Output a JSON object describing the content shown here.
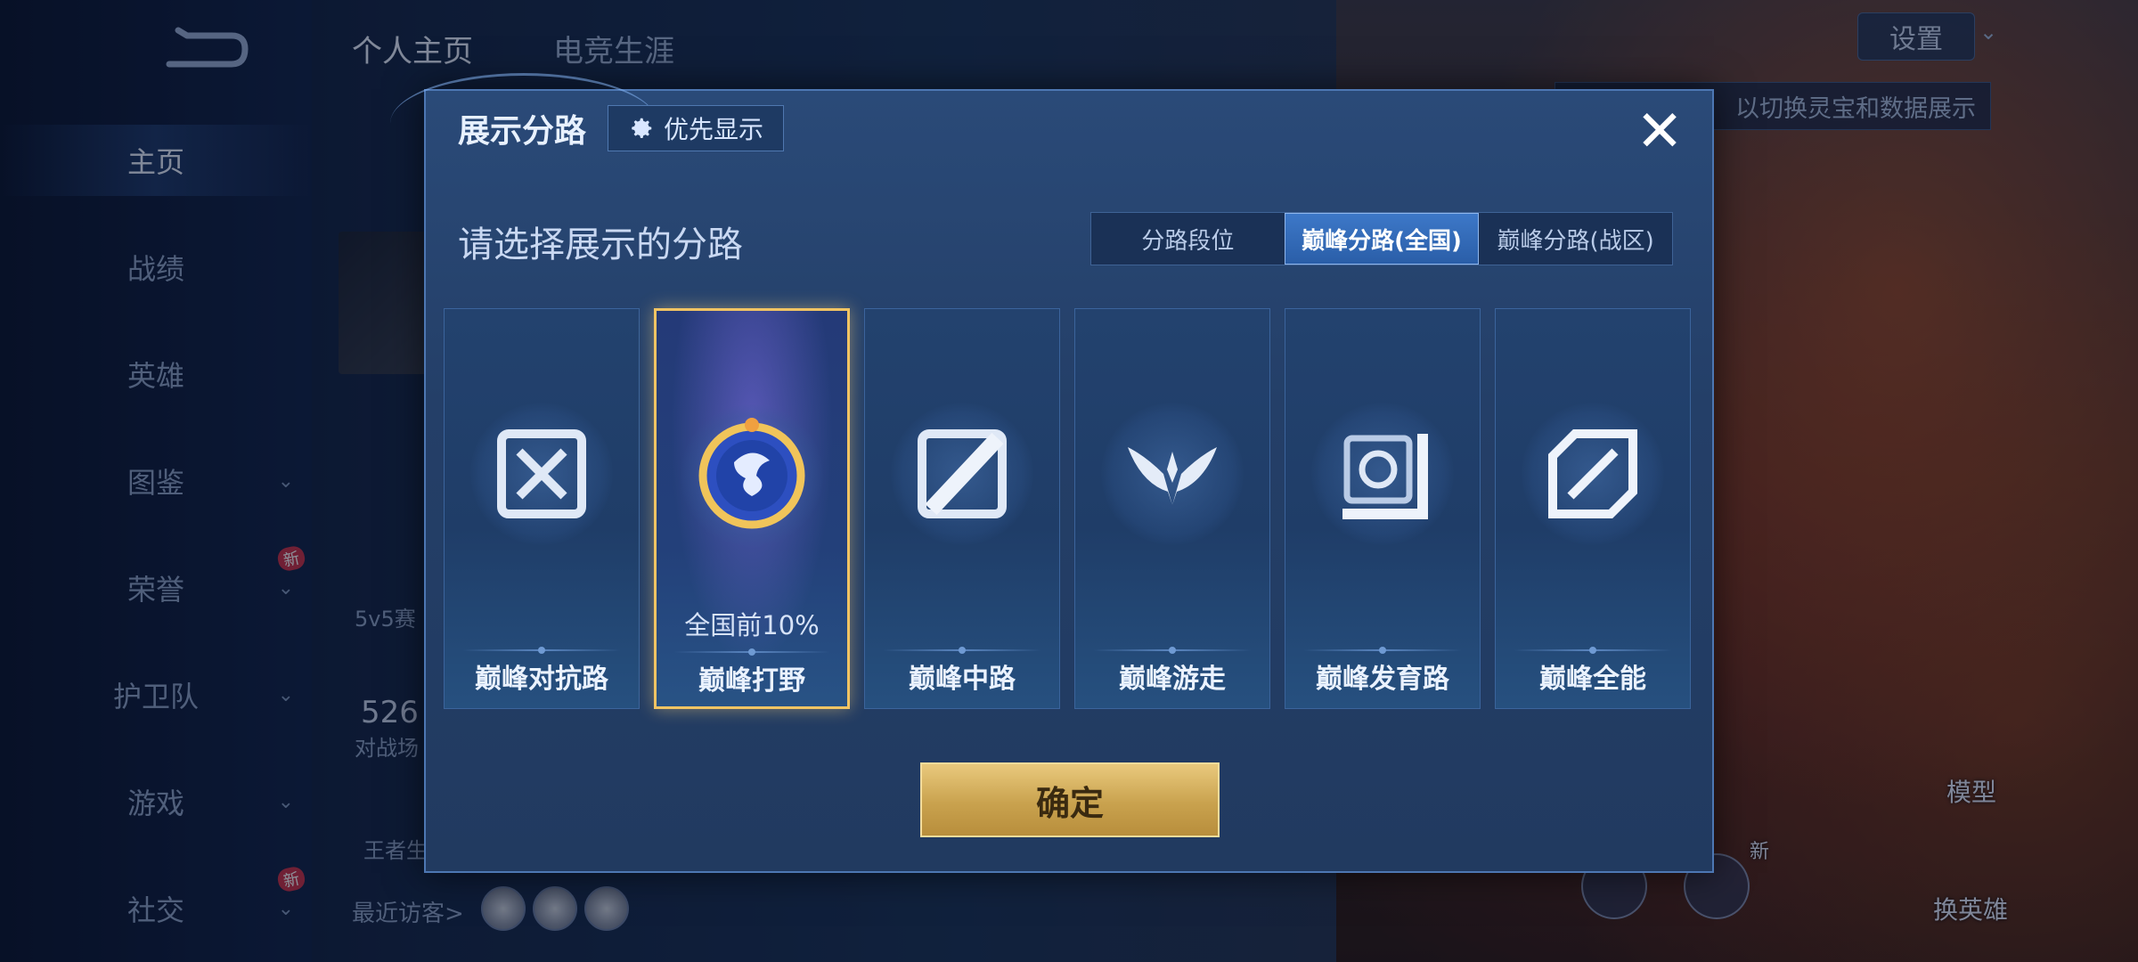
{
  "nav": {
    "items": [
      {
        "label": "主页",
        "active": true
      },
      {
        "label": "战绩"
      },
      {
        "label": "英雄"
      },
      {
        "label": "图鉴",
        "chevron": true
      },
      {
        "label": "荣誉",
        "chevron": true,
        "badge": "新"
      },
      {
        "label": "护卫队",
        "chevron": true
      },
      {
        "label": "游戏",
        "chevron": true
      },
      {
        "label": "社交",
        "chevron": true,
        "badge": "新"
      }
    ]
  },
  "header": {
    "tabs": [
      "个人主页",
      "电竞生涯"
    ],
    "settings_label": "设置",
    "hint_text": "以切换灵宝和数据展示"
  },
  "background": {
    "profile_text_1": "5v5赛",
    "profile_text_2": "526",
    "profile_text_3": "对战场",
    "profile_text_4": "王者生",
    "visitor_label": "最近访客>",
    "model_label": "模型",
    "switch_hero_label": "换英雄",
    "new_badge": "新"
  },
  "modal": {
    "title": "展示分路",
    "priority_label": "优先显示",
    "close_symbol": "✕",
    "subtitle": "请选择展示的分路",
    "segments": [
      "分路段位",
      "巅峰分路(全国)",
      "巅峰分路(战区)"
    ],
    "selected_segment": "巅峰分路(全国)",
    "lanes": [
      {
        "label": "巅峰对抗路",
        "icon": "clash-lane-icon"
      },
      {
        "label": "巅峰打野",
        "icon": "jungle-dragon-badge-icon",
        "rank": "全国前10%",
        "selected": true
      },
      {
        "label": "巅峰中路",
        "icon": "mid-lane-icon"
      },
      {
        "label": "巅峰游走",
        "icon": "roam-wings-icon"
      },
      {
        "label": "巅峰发育路",
        "icon": "farm-lane-icon"
      },
      {
        "label": "巅峰全能",
        "icon": "all-round-icon"
      }
    ],
    "confirm_label": "确定"
  },
  "colors": {
    "accent_gold": "#f2c463",
    "segment_active": "#3d78c8",
    "modal_bg": "#243f68"
  }
}
